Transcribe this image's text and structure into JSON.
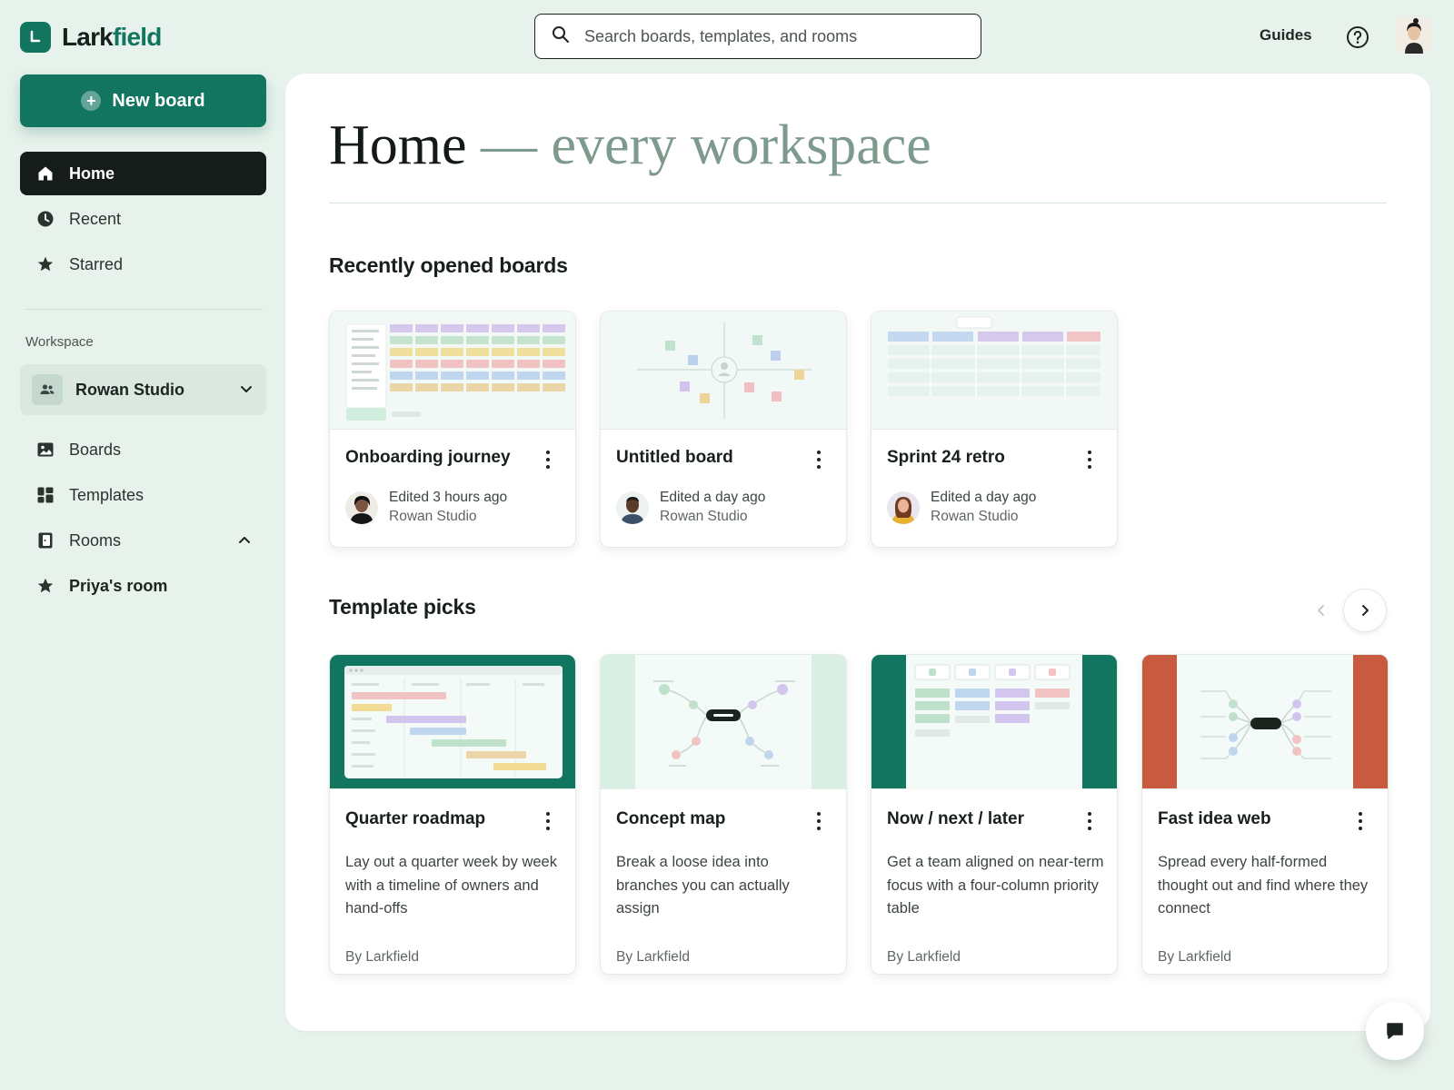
{
  "app": {
    "name_main": "Lark",
    "name_accent": "field"
  },
  "header": {
    "search_placeholder": "Search boards, templates, and rooms",
    "guides_label": "Guides"
  },
  "sidebar": {
    "new_board_label": "New board",
    "nav": [
      {
        "label": "Home",
        "icon": "home-icon",
        "active": true
      },
      {
        "label": "Recent",
        "icon": "clock-icon"
      },
      {
        "label": "Starred",
        "icon": "star-icon"
      }
    ],
    "workspace_label": "Workspace",
    "workspace_name": "Rowan Studio",
    "workspace_nav": [
      {
        "label": "Boards",
        "icon": "image-icon"
      },
      {
        "label": "Templates",
        "icon": "templates-icon"
      },
      {
        "label": "Rooms",
        "icon": "room-icon",
        "expanded": true
      },
      {
        "label": "Priya's room",
        "icon": "star-icon"
      }
    ]
  },
  "main": {
    "title": "Home",
    "subtitle": "— every workspace",
    "recent_title": "Recently opened boards",
    "recent_boards": [
      {
        "title": "Onboarding journey",
        "edited": "Edited 3 hours ago",
        "workspace": "Rowan Studio"
      },
      {
        "title": "Untitled board",
        "edited": "Edited a day ago",
        "workspace": "Rowan Studio"
      },
      {
        "title": "Sprint 24 retro",
        "edited": "Edited a day ago",
        "workspace": "Rowan Studio"
      }
    ],
    "templates_title": "Template picks",
    "templates": [
      {
        "title": "Quarter roadmap",
        "description": "Lay out a quarter week by week with a timeline of owners and hand-offs",
        "by": "By Larkfield"
      },
      {
        "title": "Concept map",
        "description": "Break a loose idea into branches you can actually assign",
        "by": "By Larkfield"
      },
      {
        "title": "Now / next / later",
        "description": "Get a team aligned on near-term focus with a four-column priority table",
        "by": "By Larkfield"
      },
      {
        "title": "Fast idea web",
        "description": "Spread every half-formed thought out and find where they connect",
        "by": "By Larkfield"
      }
    ]
  },
  "colors": {
    "brand": "#127560",
    "background": "#e8f2ec",
    "active_nav": "#151c19",
    "accent_red": "#c85a3f"
  }
}
